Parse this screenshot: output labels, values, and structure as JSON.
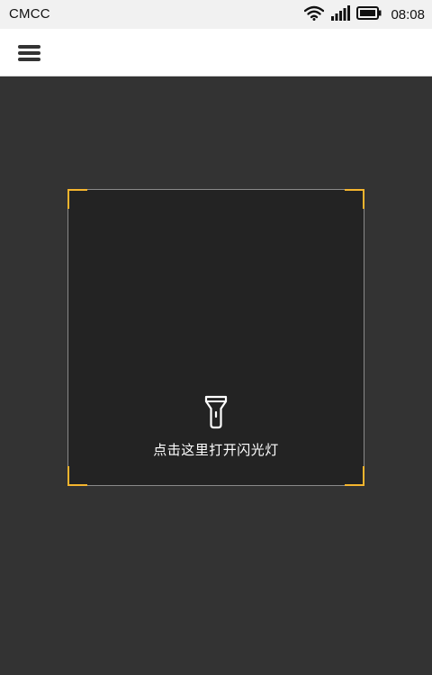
{
  "status_bar": {
    "carrier": "CMCC",
    "time": "08:08",
    "icons": [
      "wifi-icon",
      "signal-icon",
      "battery-icon"
    ]
  },
  "app_bar": {
    "menu_icon": "hamburger-menu-icon"
  },
  "flashlight": {
    "label": "点击这里打开闪光灯",
    "icon": "flashlight-icon"
  },
  "colors": {
    "background": "#333333",
    "frame_background": "#232323",
    "corner_accent": "#f5b52e",
    "frame_border": "#8a8a8a"
  }
}
